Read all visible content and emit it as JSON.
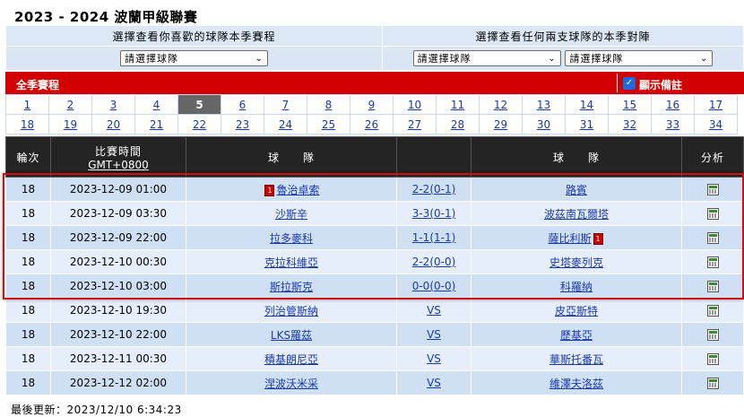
{
  "title": "2023 - 2024 波蘭甲級聯賽",
  "selectors": {
    "team_header": "選擇查看你喜歡的球隊本季賽程",
    "h2h_header": "選擇查看任何兩支球隊的本季對陣",
    "team_select": "請選擇球隊",
    "h2h_select_a": "請選擇球隊",
    "h2h_select_b": "請選擇球隊"
  },
  "season_bar": {
    "label": "全季賽程",
    "show_notes_label": "顯示備註",
    "show_notes_checked": true
  },
  "rounds": {
    "row1": [
      "1",
      "2",
      "3",
      "4",
      "5",
      "6",
      "7",
      "8",
      "9",
      "10",
      "11",
      "12",
      "13",
      "14",
      "15",
      "16",
      "17"
    ],
    "row2": [
      "18",
      "19",
      "20",
      "21",
      "22",
      "23",
      "24",
      "25",
      "26",
      "27",
      "28",
      "29",
      "30",
      "31",
      "32",
      "33",
      "34"
    ],
    "current": "5"
  },
  "table": {
    "headers": {
      "round": "輪次",
      "time": "比賽時間",
      "tz": "GMT+0800",
      "home": "球　　隊",
      "score": "",
      "away": "球　　隊",
      "analysis": "分析"
    },
    "rows": [
      {
        "round": "18",
        "time": "2023-12-09 01:00",
        "home": "魯治卓索",
        "home_card": "1",
        "score": "2-2(0-1)",
        "away": "路賓",
        "away_card": ""
      },
      {
        "round": "18",
        "time": "2023-12-09 03:30",
        "home": "沙斯辛",
        "home_card": "",
        "score": "3-3(0-1)",
        "away": "波茲南瓦爾塔",
        "away_card": ""
      },
      {
        "round": "18",
        "time": "2023-12-09 22:00",
        "home": "拉多麥科",
        "home_card": "",
        "score": "1-1(1-1)",
        "away": "薩比利斯",
        "away_card": "1"
      },
      {
        "round": "18",
        "time": "2023-12-10 00:30",
        "home": "克拉科維亞",
        "home_card": "",
        "score": "2-2(0-0)",
        "away": "史塔麥列克",
        "away_card": ""
      },
      {
        "round": "18",
        "time": "2023-12-10 03:00",
        "home": "斯拉斯克",
        "home_card": "",
        "score": "0-0(0-0)",
        "away": "科羅納",
        "away_card": ""
      },
      {
        "round": "18",
        "time": "2023-12-10 19:30",
        "home": "列治管斯納",
        "home_card": "",
        "score": "VS",
        "away": "皮亞斯特",
        "away_card": ""
      },
      {
        "round": "18",
        "time": "2023-12-10 22:00",
        "home": "LKS羅茲",
        "home_card": "",
        "score": "VS",
        "away": "歷基亞",
        "away_card": ""
      },
      {
        "round": "18",
        "time": "2023-12-11 00:30",
        "home": "積基朗尼亞",
        "home_card": "",
        "score": "VS",
        "away": "華斯托番瓦",
        "away_card": ""
      },
      {
        "round": "18",
        "time": "2023-12-12 02:00",
        "home": "涅波沃米采",
        "home_card": "",
        "score": "VS",
        "away": "維澤夫洛茲",
        "away_card": ""
      }
    ]
  },
  "footer": "最後更新：2023/12/10 6:34:23",
  "colors": {
    "accent_red": "#d20000",
    "header_dark": "#242424",
    "row_odd": "#cfe0f5",
    "row_even": "#e6eefb",
    "link": "#1a39a8"
  }
}
